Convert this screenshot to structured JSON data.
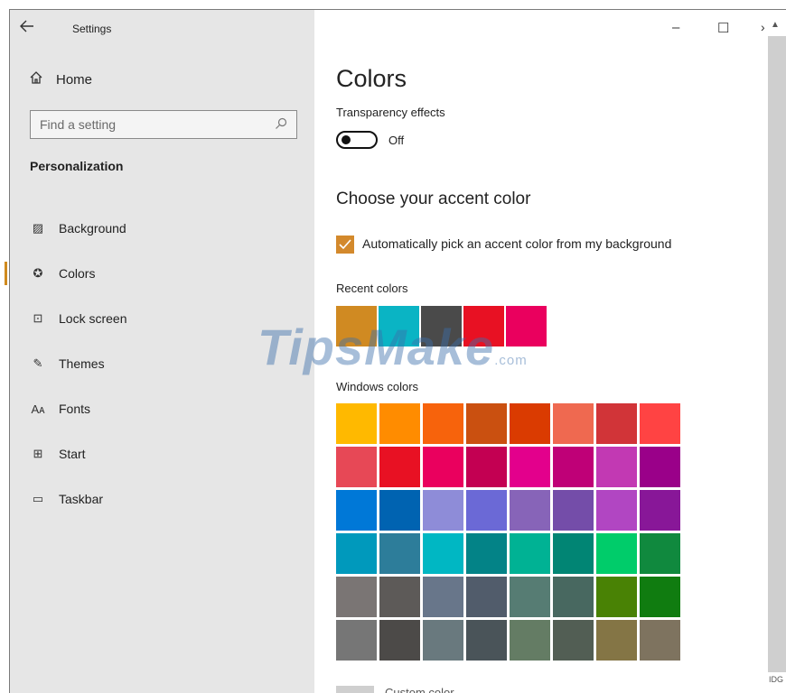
{
  "window": {
    "title": "Settings",
    "minimize": "–",
    "maximize": "☐",
    "close": "›"
  },
  "sidebar": {
    "home": "Home",
    "search_placeholder": "Find a setting",
    "section": "Personalization",
    "items": [
      {
        "label": "Background",
        "icon": "picture-icon",
        "glyph": "▨"
      },
      {
        "label": "Colors",
        "icon": "palette-icon",
        "glyph": "✪"
      },
      {
        "label": "Lock screen",
        "icon": "lock-screen-icon",
        "glyph": "⊡"
      },
      {
        "label": "Themes",
        "icon": "themes-icon",
        "glyph": "✎"
      },
      {
        "label": "Fonts",
        "icon": "fonts-icon",
        "glyph": "Aᴀ"
      },
      {
        "label": "Start",
        "icon": "start-icon",
        "glyph": "⊞"
      },
      {
        "label": "Taskbar",
        "icon": "taskbar-icon",
        "glyph": "▭"
      }
    ],
    "active_index": 1
  },
  "main": {
    "title": "Colors",
    "transparency_label": "Transparency effects",
    "transparency_state": "Off",
    "accent_heading": "Choose your accent color",
    "auto_pick_label": "Automatically pick an accent color from my background",
    "recent_label": "Recent colors",
    "recent_colors": [
      "#d08a22",
      "#0ab4c4",
      "#4a4a4a",
      "#e81123",
      "#ea005e"
    ],
    "windows_label": "Windows colors",
    "windows_colors": [
      [
        "#ffb900",
        "#ff8c00",
        "#f7630c",
        "#ca5010",
        "#da3b01",
        "#ef6950",
        "#d13438",
        "#ff4343"
      ],
      [
        "#e74856",
        "#e81123",
        "#ea005e",
        "#c30052",
        "#e3008c",
        "#bf0077",
        "#c239b3",
        "#9a0089"
      ],
      [
        "#0078d7",
        "#0063b1",
        "#8e8cd8",
        "#6b69d6",
        "#8764b8",
        "#744da9",
        "#b146c2",
        "#881798"
      ],
      [
        "#0099bc",
        "#2d7d9a",
        "#00b7c3",
        "#038387",
        "#00b294",
        "#018574",
        "#00cc6a",
        "#10893e"
      ],
      [
        "#7a7574",
        "#5d5a58",
        "#68768a",
        "#515c6b",
        "#567c73",
        "#486860",
        "#498205",
        "#107c10"
      ],
      [
        "#767676",
        "#4c4a48",
        "#69797e",
        "#4a5459",
        "#647c64",
        "#525e54",
        "#847545",
        "#7e735f"
      ]
    ],
    "custom_label": "Custom color"
  },
  "watermark": {
    "text": "TipsMake",
    "suffix": ".com"
  },
  "corner_text": "IDG"
}
